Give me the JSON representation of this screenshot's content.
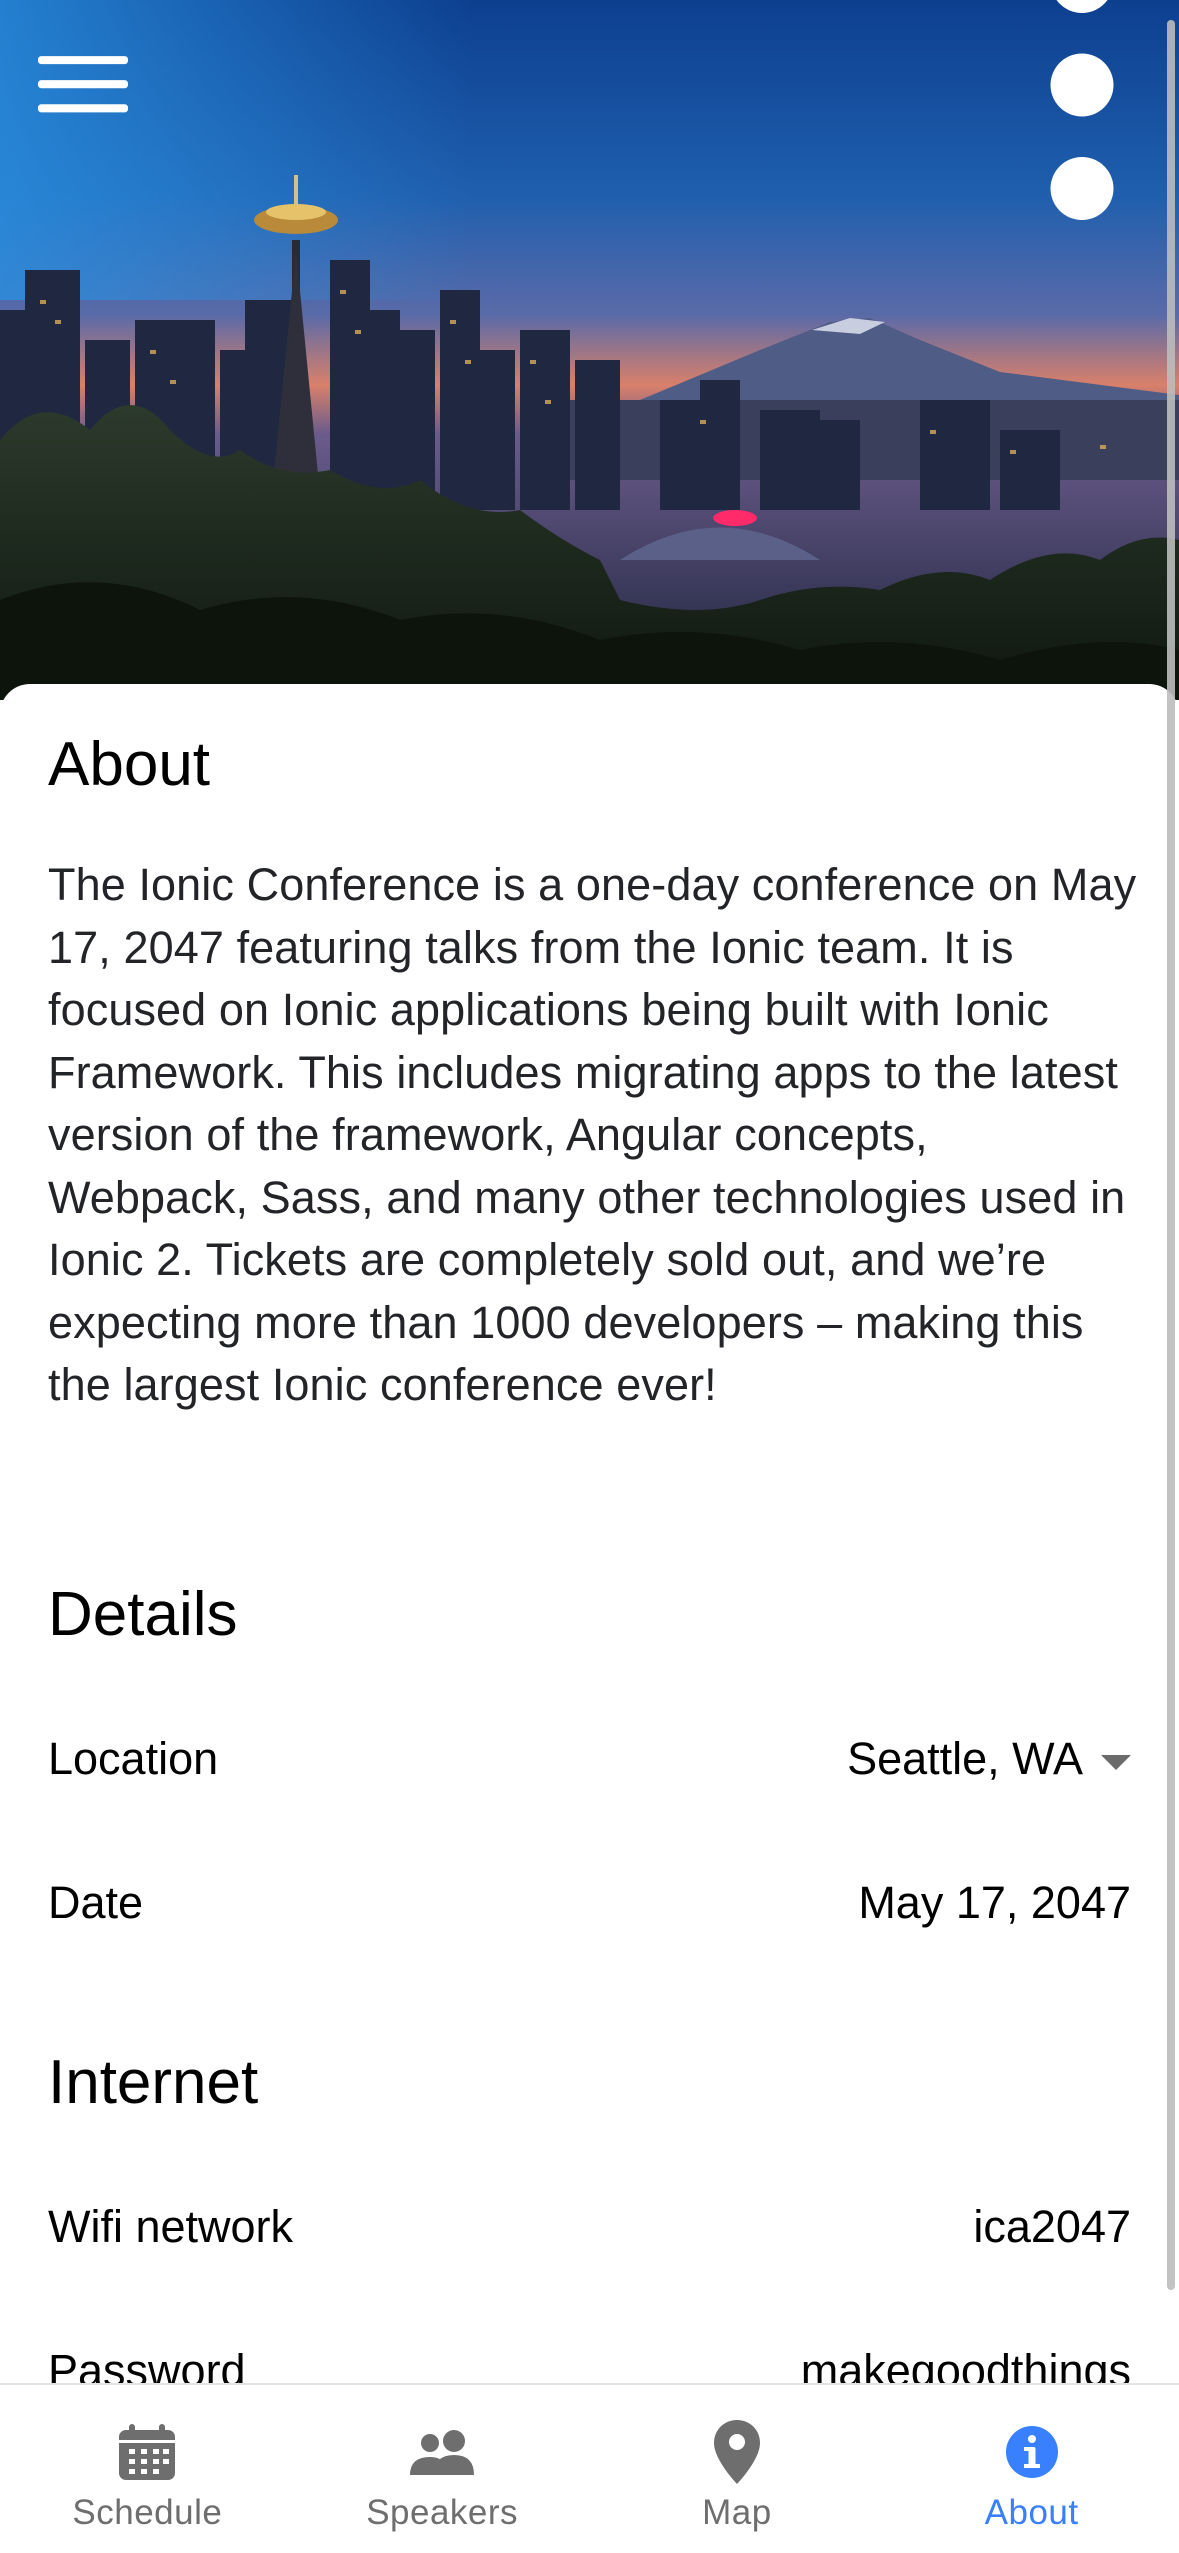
{
  "header": {
    "menu_icon": "menu-icon",
    "more_icon": "more-vertical-icon",
    "hero_image": "Seattle skyline at dusk with Space Needle and Mount Rainier"
  },
  "about": {
    "title": "About",
    "text": "The Ionic Conference is a one-day conference on May 17, 2047 featuring talks from the Ionic team. It is focused on Ionic applications being built with Ionic Framework. This includes migrating apps to the latest version of the framework, Angular concepts, Webpack, Sass, and many other technologies used in Ionic 2. Tickets are completely sold out, and we’re expecting more than 1000 developers – making this the largest Ionic conference ever!"
  },
  "details": {
    "title": "Details",
    "location_label": "Location",
    "location_value": "Seattle, WA",
    "date_label": "Date",
    "date_value": "May 17, 2047"
  },
  "internet": {
    "title": "Internet",
    "wifi_label": "Wifi network",
    "wifi_value": "ica2047",
    "password_label": "Password",
    "password_value": "makegoodthings"
  },
  "tabs": [
    {
      "label": "Schedule",
      "icon": "calendar-icon",
      "active": false
    },
    {
      "label": "Speakers",
      "icon": "people-icon",
      "active": false
    },
    {
      "label": "Map",
      "icon": "location-pin-icon",
      "active": false
    },
    {
      "label": "About",
      "icon": "info-icon",
      "active": true
    }
  ],
  "colors": {
    "accent": "#3880ff",
    "tab_inactive": "#6e6e6e",
    "text": "#222428"
  }
}
